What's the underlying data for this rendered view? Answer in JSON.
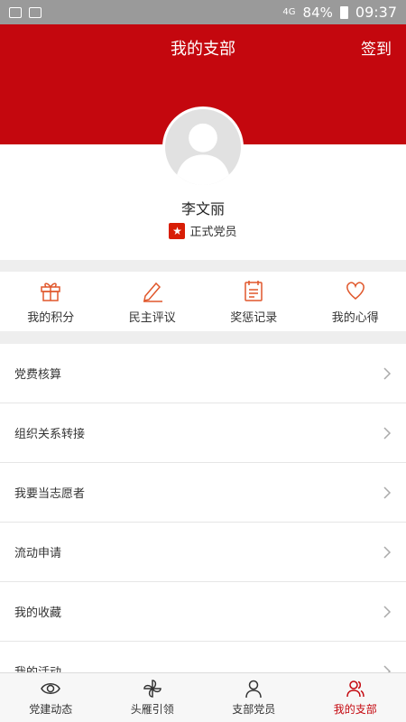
{
  "status_bar": {
    "battery": "84%",
    "time": "09:37",
    "network": "4G"
  },
  "header": {
    "title": "我的支部",
    "checkin_label": "签到"
  },
  "profile": {
    "name": "李文丽",
    "member_status": "正式党员",
    "badge_icon": "star-badge-icon"
  },
  "actions": [
    {
      "label": "我的积分",
      "icon": "gift-icon"
    },
    {
      "label": "民主评议",
      "icon": "pen-icon"
    },
    {
      "label": "奖惩记录",
      "icon": "calendar-icon"
    },
    {
      "label": "我的心得",
      "icon": "heart-icon"
    }
  ],
  "menu": [
    {
      "label": "党费核算"
    },
    {
      "label": "组织关系转接"
    },
    {
      "label": "我要当志愿者"
    },
    {
      "label": "流动申请"
    },
    {
      "label": "我的收藏"
    },
    {
      "label": "我的活动"
    }
  ],
  "tabs": [
    {
      "label": "党建动态",
      "icon": "eye-icon",
      "active": false
    },
    {
      "label": "头雁引领",
      "icon": "pinwheel-icon",
      "active": false
    },
    {
      "label": "支部党员",
      "icon": "person-icon",
      "active": false
    },
    {
      "label": "我的支部",
      "icon": "people-icon",
      "active": true
    }
  ],
  "colors": {
    "brand_red": "#c4070e",
    "icon_orange": "#e0572b"
  }
}
